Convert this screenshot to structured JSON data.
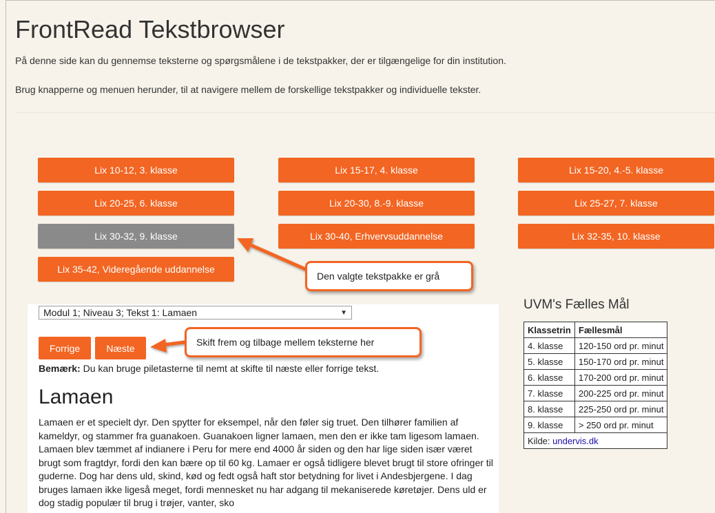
{
  "page": {
    "title": "FrontRead Tekstbrowser",
    "intro1": "På denne side kan du gennemse teksterne og spørgsmålene i de tekstpakker, der er tilgængelige for din institution.",
    "intro2": "Brug knapperne og menuen herunder, til at navigere mellem de forskellige tekstpakker og individuelle tekster."
  },
  "packages": [
    {
      "label": "Lix 10-12, 3. klasse",
      "selected": false
    },
    {
      "label": "Lix 15-17, 4. klasse",
      "selected": false
    },
    {
      "label": "Lix 15-20, 4.-5. klasse",
      "selected": false
    },
    {
      "label": "Lix 20-25, 6. klasse",
      "selected": false
    },
    {
      "label": "Lix 20-30, 8.-9. klasse",
      "selected": false
    },
    {
      "label": "Lix 25-27, 7. klasse",
      "selected": false
    },
    {
      "label": "Lix 30-32, 9. klasse",
      "selected": true
    },
    {
      "label": "Lix 30-40, Erhvervsuddannelse",
      "selected": false
    },
    {
      "label": "Lix 32-35, 10. klasse",
      "selected": false
    },
    {
      "label": "Lix 35-42, Videregående uddannelse",
      "selected": false
    }
  ],
  "callouts": {
    "package_note": "Den valgte tekstpakke er grå",
    "nav_note": "Skift frem og tilbage mellem teksterne her"
  },
  "reader": {
    "text_select_value": "Modul 1; Niveau 3; Tekst 1: Lamaen",
    "prev_label": "Forrige",
    "next_label": "Næste",
    "note_bold": "Bemærk:",
    "note_text": " Du kan bruge piletasterne til nemt at skifte til næste eller forrige tekst.",
    "article_title": "Lamaen",
    "article_body": "Lamaen er et specielt dyr. Den spytter for eksempel, når den føler sig truet. Den tilhører familien af kameldyr, og stammer fra guanakoen. Guanakoen ligner lamaen, men den er ikke tam ligesom lamaen. Lamaen blev tæmmet af indianere i Peru for mere end 4000 år siden og den har lige siden især været brugt som fragtdyr, fordi den kan bære op til 60 kg. Lamaer er også tidligere blevet brugt til store ofringer til guderne. Dog har dens uld, skind, kød og fedt også haft stor betydning for livet i Andesbjergene. I dag bruges lamaen ikke ligeså meget, fordi mennesket nu har adgang til mekaniserede køretøjer. Dens uld er dog stadig populær til brug i trøjer, vanter, sko"
  },
  "uvm": {
    "title": "UVM's Fælles Mål",
    "headers": [
      "Klassetrin",
      "Fællesmål"
    ],
    "rows": [
      [
        "4. klasse",
        "120-150 ord pr. minut"
      ],
      [
        "5. klasse",
        "150-170 ord pr. minut"
      ],
      [
        "6. klasse",
        "170-200 ord pr. minut"
      ],
      [
        "7. klasse",
        "200-225 ord pr. minut"
      ],
      [
        "8. klasse",
        "225-250 ord pr. minut"
      ],
      [
        "9. klasse",
        "> 250 ord pr. minut"
      ]
    ],
    "source_label": "Kilde: ",
    "source_link": "undervis.dk"
  },
  "colors": {
    "accent": "#f26522",
    "selected": "#8a8a8a",
    "background": "#f7f3ea"
  }
}
